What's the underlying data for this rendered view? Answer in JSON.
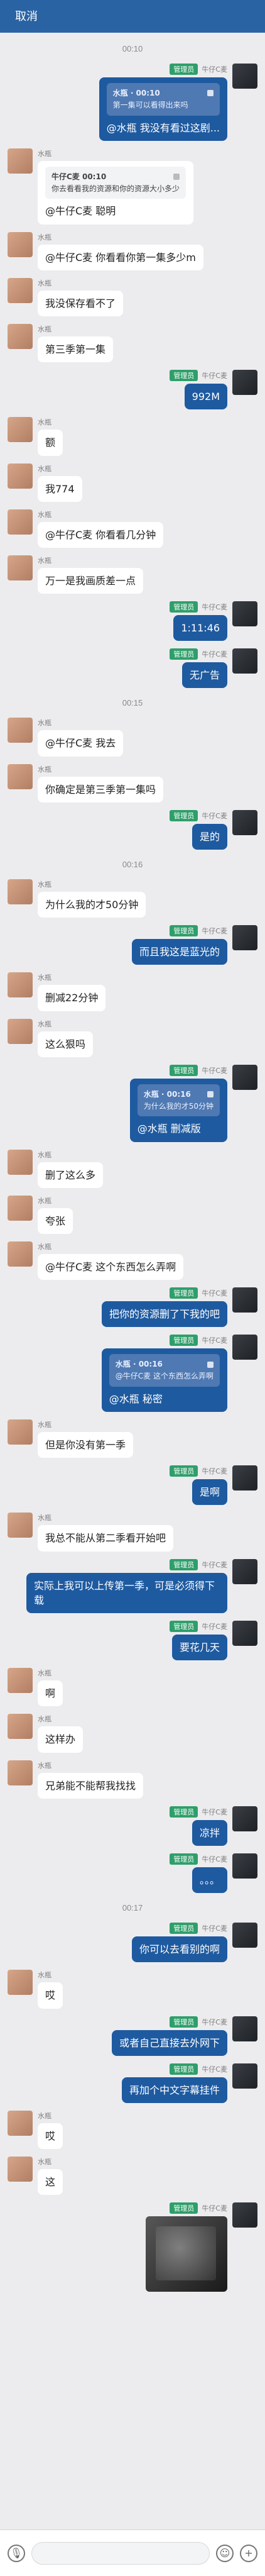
{
  "header": {
    "cancel_label": "取消"
  },
  "icons": {
    "microphone_icon": "microphone-icon",
    "emoji_icon": "emoji-icon",
    "plus_icon": "plus-icon"
  },
  "messages": [
    {
      "type": "time",
      "text": "00:10"
    },
    {
      "type": "message",
      "side": "right",
      "sender": "牛仔C麦",
      "badge": "管理员",
      "quote_title": "水瓶 · 00:10",
      "quote_text": "第一集可以看得出来吗",
      "text": "@水瓶  我没有看过这剧..."
    },
    {
      "type": "message",
      "side": "left",
      "sender": "水瓶",
      "quote_title": "牛仔C麦 00:10",
      "quote_text": "你去看看我的资源和你的资源大小多少",
      "text": "@牛仔C麦  聪明"
    },
    {
      "type": "message",
      "side": "left",
      "sender": "水瓶",
      "text": "@牛仔C麦  你看看你第一集多少m"
    },
    {
      "type": "message",
      "side": "left",
      "sender": "水瓶",
      "text": "我没保存看不了"
    },
    {
      "type": "message",
      "side": "left",
      "sender": "水瓶",
      "text": "第三季第一集"
    },
    {
      "type": "message",
      "side": "right",
      "sender": "牛仔C麦",
      "badge": "管理员",
      "text": "992M"
    },
    {
      "type": "message",
      "side": "left",
      "sender": "水瓶",
      "text": "额"
    },
    {
      "type": "message",
      "side": "left",
      "sender": "水瓶",
      "text": "我774"
    },
    {
      "type": "message",
      "side": "left",
      "sender": "水瓶",
      "text": "@牛仔C麦  你看看几分钟"
    },
    {
      "type": "message",
      "side": "left",
      "sender": "水瓶",
      "text": "万一是我画质差一点"
    },
    {
      "type": "message",
      "side": "right",
      "sender": "牛仔C麦",
      "badge": "管理员",
      "text": "1:11:46"
    },
    {
      "type": "message",
      "side": "right",
      "sender": "牛仔C麦",
      "badge": "管理员",
      "text": "无广告"
    },
    {
      "type": "time",
      "text": "00:15"
    },
    {
      "type": "message",
      "side": "left",
      "sender": "水瓶",
      "text": "@牛仔C麦  我去"
    },
    {
      "type": "message",
      "side": "left",
      "sender": "水瓶",
      "text": "你确定是第三季第一集吗"
    },
    {
      "type": "message",
      "side": "right",
      "sender": "牛仔C麦",
      "badge": "管理员",
      "text": "是的"
    },
    {
      "type": "time",
      "text": "00:16"
    },
    {
      "type": "message",
      "side": "left",
      "sender": "水瓶",
      "text": "为什么我的才50分钟"
    },
    {
      "type": "message",
      "side": "right",
      "sender": "牛仔C麦",
      "badge": "管理员",
      "text": "而且我这是蓝光的"
    },
    {
      "type": "message",
      "side": "left",
      "sender": "水瓶",
      "text": "删减22分钟"
    },
    {
      "type": "message",
      "side": "left",
      "sender": "水瓶",
      "text": "这么狠吗"
    },
    {
      "type": "message",
      "side": "right",
      "sender": "牛仔C麦",
      "badge": "管理员",
      "quote_title": "水瓶 · 00:16",
      "quote_text": "为什么我的才50分钟",
      "text": "@水瓶  删减版"
    },
    {
      "type": "message",
      "side": "left",
      "sender": "水瓶",
      "text": "删了这么多"
    },
    {
      "type": "message",
      "side": "left",
      "sender": "水瓶",
      "text": "夸张"
    },
    {
      "type": "message",
      "side": "left",
      "sender": "水瓶",
      "text": "@牛仔C麦  这个东西怎么弄啊"
    },
    {
      "type": "message",
      "side": "right",
      "sender": "牛仔C麦",
      "badge": "管理员",
      "text": "把你的资源删了下我的吧"
    },
    {
      "type": "message",
      "side": "right",
      "sender": "牛仔C麦",
      "badge": "管理员",
      "quote_title": "水瓶 · 00:16",
      "quote_text": "@牛仔C麦  这个东西怎么弄啊",
      "text": "@水瓶  秘密"
    },
    {
      "type": "message",
      "side": "left",
      "sender": "水瓶",
      "text": "但是你没有第一季"
    },
    {
      "type": "message",
      "side": "right",
      "sender": "牛仔C麦",
      "badge": "管理员",
      "text": "是啊"
    },
    {
      "type": "message",
      "side": "left",
      "sender": "水瓶",
      "text": "我总不能从第二季看开始吧"
    },
    {
      "type": "message",
      "side": "right",
      "sender": "牛仔C麦",
      "badge": "管理员",
      "text": "实际上我可以上传第一季，可是必须得下载"
    },
    {
      "type": "message",
      "side": "right",
      "sender": "牛仔C麦",
      "badge": "管理员",
      "text": "要花几天"
    },
    {
      "type": "message",
      "side": "left",
      "sender": "水瓶",
      "text": "啊"
    },
    {
      "type": "message",
      "side": "left",
      "sender": "水瓶",
      "text": "这样办"
    },
    {
      "type": "message",
      "side": "left",
      "sender": "水瓶",
      "text": "兄弟能不能帮我找找"
    },
    {
      "type": "message",
      "side": "right",
      "sender": "牛仔C麦",
      "badge": "管理员",
      "text": "凉拌"
    },
    {
      "type": "message",
      "side": "right",
      "sender": "牛仔C麦",
      "badge": "管理员",
      "text": "。。。"
    },
    {
      "type": "time",
      "text": "00:17"
    },
    {
      "type": "message",
      "side": "right",
      "sender": "牛仔C麦",
      "badge": "管理员",
      "text": "你可以去看别的啊"
    },
    {
      "type": "message",
      "side": "left",
      "sender": "水瓶",
      "text": "哎"
    },
    {
      "type": "message",
      "side": "right",
      "sender": "牛仔C麦",
      "badge": "管理员",
      "text": "或者自己直接去外网下"
    },
    {
      "type": "message",
      "side": "right",
      "sender": "牛仔C麦",
      "badge": "管理员",
      "text": "再加个中文字幕挂件"
    },
    {
      "type": "message",
      "side": "left",
      "sender": "水瓶",
      "text": "哎"
    },
    {
      "type": "message",
      "side": "left",
      "sender": "水瓶",
      "text": "这"
    },
    {
      "type": "image",
      "side": "right",
      "sender": "牛仔C麦",
      "badge": "管理员"
    }
  ]
}
